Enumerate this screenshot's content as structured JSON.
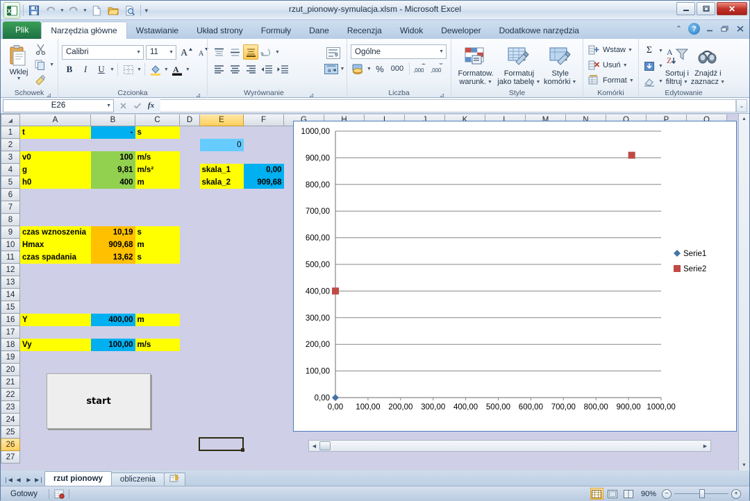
{
  "window": {
    "title": "rzut_pionowy-symulacja.xlsm  -  Microsoft Excel",
    "minimize": "–",
    "maximize": "❐",
    "close": "✕"
  },
  "qat": {
    "excel_logo": "X",
    "save": "save-icon",
    "undo": "↶",
    "redo": "↷",
    "new": "new-icon",
    "open": "open-icon",
    "print_preview": "print-preview-icon",
    "customize": "▼"
  },
  "ribbon_tabs": [
    {
      "label": "Plik",
      "type": "file"
    },
    {
      "label": "Narzędzia główne",
      "type": "active"
    },
    {
      "label": "Wstawianie",
      "type": "normal"
    },
    {
      "label": "Układ strony",
      "type": "normal"
    },
    {
      "label": "Formuły",
      "type": "normal"
    },
    {
      "label": "Dane",
      "type": "normal"
    },
    {
      "label": "Recenzja",
      "type": "normal"
    },
    {
      "label": "Widok",
      "type": "normal"
    },
    {
      "label": "Deweloper",
      "type": "normal"
    },
    {
      "label": "Dodatkowe narzędzia",
      "type": "normal"
    }
  ],
  "ribbon_right": {
    "collapse": "⌃",
    "help": "?",
    "minimize": "–",
    "restore": "❐",
    "close": "✕"
  },
  "groups": {
    "clipboard": {
      "label": "Schowek",
      "paste": "Wklej",
      "cut": "cut-icon",
      "copy": "copy-icon",
      "format_painter": "format-painter-icon"
    },
    "font": {
      "label": "Czcionka",
      "font_name": "Calibri",
      "font_size": "11",
      "grow": "A",
      "shrink": "A",
      "bold": "B",
      "italic": "I",
      "underline": "U",
      "borders": "borders-icon",
      "fill": "fill-color-icon",
      "fontcolor": "font-color-icon"
    },
    "alignment": {
      "label": "Wyrównanie",
      "top": "align-top-icon",
      "middle": "align-middle-icon",
      "bottom": "align-bottom-icon",
      "orientation": "orientation-icon",
      "left": "align-left-icon",
      "center": "align-center-icon",
      "right": "align-right-icon",
      "decrease_indent": "decrease-indent-icon",
      "increase_indent": "increase-indent-icon",
      "wrap_text": "wrap-text-icon",
      "merge": "merge-cells-icon"
    },
    "number": {
      "label": "Liczba",
      "format": "Ogólne",
      "currency": "currency-icon",
      "percent": "%",
      "comma": "000",
      "increase_decimal": "increase-decimal-icon",
      "decrease_decimal": "decrease-decimal-icon"
    },
    "styles": {
      "label": "Style",
      "conditional": "Formatow.\nwarunk.",
      "conditional_l1": "Formatow.",
      "conditional_l2": "warunk.",
      "as_table_l1": "Formatuj",
      "as_table_l2": "jako tabelę",
      "cell_styles_l1": "Style",
      "cell_styles_l2": "komórki"
    },
    "cells": {
      "label": "Komórki",
      "insert": "Wstaw",
      "delete": "Usuń",
      "format": "Format"
    },
    "editing": {
      "label": "Edytowanie",
      "autosum": "Σ",
      "fill": "fill-down-icon",
      "clear": "clear-icon",
      "sort_l1": "Sortuj i",
      "sort_l2": "filtruj",
      "find_l1": "Znajdź i",
      "find_l2": "zaznacz"
    }
  },
  "formula_bar": {
    "name_box": "E26",
    "formula": "",
    "fx": "fx",
    "cancel": "✕",
    "accept": "✓",
    "expand": "⌄"
  },
  "grid": {
    "columns": [
      "A",
      "B",
      "C",
      "D",
      "E",
      "F",
      "G",
      "H",
      "I",
      "J",
      "K",
      "L",
      "M",
      "N",
      "O",
      "P",
      "Q"
    ],
    "selected_column": "E",
    "selected_row": 26,
    "selected_cell": "E26",
    "rows": [
      1,
      2,
      3,
      4,
      5,
      6,
      7,
      8,
      9,
      10,
      11,
      12,
      13,
      14,
      15,
      16,
      17,
      18,
      19,
      20,
      21,
      22,
      23,
      24,
      25,
      26,
      27
    ],
    "cells": [
      {
        "row": 1,
        "col": "A",
        "value": "t",
        "style": "yl"
      },
      {
        "row": 1,
        "col": "B",
        "value": "-",
        "style": "cy"
      },
      {
        "row": 1,
        "col": "C",
        "value": "s",
        "style": "yl"
      },
      {
        "row": 2,
        "col": "E",
        "value": "0",
        "style": "cy2"
      },
      {
        "row": 3,
        "col": "A",
        "value": "v0",
        "style": "yl"
      },
      {
        "row": 3,
        "col": "B",
        "value": "100",
        "style": "gr"
      },
      {
        "row": 3,
        "col": "C",
        "value": "m/s",
        "style": "yl"
      },
      {
        "row": 4,
        "col": "A",
        "value": "g",
        "style": "yl"
      },
      {
        "row": 4,
        "col": "B",
        "value": "9,81",
        "style": "gr"
      },
      {
        "row": 4,
        "col": "C",
        "value": "m/s²",
        "style": "yl"
      },
      {
        "row": 4,
        "col": "E",
        "value": "skala_1",
        "style": "yl"
      },
      {
        "row": 4,
        "col": "F",
        "value": "0,00",
        "style": "cy"
      },
      {
        "row": 5,
        "col": "A",
        "value": "h0",
        "style": "yl"
      },
      {
        "row": 5,
        "col": "B",
        "value": "400",
        "style": "gr"
      },
      {
        "row": 5,
        "col": "C",
        "value": "m",
        "style": "yl"
      },
      {
        "row": 5,
        "col": "E",
        "value": "skala_2",
        "style": "yl"
      },
      {
        "row": 5,
        "col": "F",
        "value": "909,68",
        "style": "cy"
      },
      {
        "row": 9,
        "col": "A",
        "value": "czas wznoszenia",
        "style": "yl"
      },
      {
        "row": 9,
        "col": "B",
        "value": "10,19",
        "style": "og"
      },
      {
        "row": 9,
        "col": "C",
        "value": "s",
        "style": "yl"
      },
      {
        "row": 10,
        "col": "A",
        "value": "Hmax",
        "style": "yl"
      },
      {
        "row": 10,
        "col": "B",
        "value": "909,68",
        "style": "og"
      },
      {
        "row": 10,
        "col": "C",
        "value": "m",
        "style": "yl"
      },
      {
        "row": 11,
        "col": "A",
        "value": "czas spadania",
        "style": "yl"
      },
      {
        "row": 11,
        "col": "B",
        "value": "13,62",
        "style": "og"
      },
      {
        "row": 11,
        "col": "C",
        "value": "s",
        "style": "yl"
      },
      {
        "row": 16,
        "col": "A",
        "value": "Y",
        "style": "yl"
      },
      {
        "row": 16,
        "col": "B",
        "value": "400,00",
        "style": "cy"
      },
      {
        "row": 16,
        "col": "C",
        "value": "m",
        "style": "yl"
      },
      {
        "row": 18,
        "col": "A",
        "value": "Vy",
        "style": "yl"
      },
      {
        "row": 18,
        "col": "B",
        "value": "100,00",
        "style": "cy"
      },
      {
        "row": 18,
        "col": "C",
        "value": "m/s",
        "style": "yl"
      }
    ]
  },
  "start_button": {
    "label": "start"
  },
  "chart_data": {
    "type": "scatter",
    "title": "",
    "xlabel": "",
    "ylabel": "",
    "xlim": [
      0,
      1000
    ],
    "ylim": [
      0,
      1000
    ],
    "xticks": [
      "0,00",
      "100,00",
      "200,00",
      "300,00",
      "400,00",
      "500,00",
      "600,00",
      "700,00",
      "800,00",
      "900,00",
      "1000,00"
    ],
    "yticks": [
      "0,00",
      "100,00",
      "200,00",
      "300,00",
      "400,00",
      "500,00",
      "600,00",
      "700,00",
      "800,00",
      "900,00",
      "1000,00"
    ],
    "grid": "horizontal",
    "legend_position": "right",
    "series": [
      {
        "name": "Serie1",
        "color": "#4572a7",
        "marker": "diamond",
        "points": [
          {
            "x": 0,
            "y": 0
          }
        ]
      },
      {
        "name": "Serie2",
        "color": "#bf4a45",
        "marker": "square",
        "points": [
          {
            "x": 0,
            "y": 400
          },
          {
            "x": 909.68,
            "y": 909.68
          }
        ]
      }
    ]
  },
  "sheet_tabs": {
    "nav_first": "❘◀",
    "nav_prev": "◀",
    "nav_next": "▶",
    "nav_last": "▶❘",
    "tabs": [
      {
        "label": "rzut pionowy",
        "active": true
      },
      {
        "label": "obliczenia",
        "active": false
      }
    ],
    "new_sheet": "new-sheet-icon"
  },
  "scrollbars": {
    "left_arrow": "◀",
    "right_arrow": "▶",
    "up_arrow": "▲",
    "down_arrow": "▼"
  },
  "status_bar": {
    "status": "Gotowy",
    "macro_record": "record-macro-icon",
    "view_normal": "normal-view-icon",
    "view_layout": "page-layout-view-icon",
    "view_break": "page-break-view-icon",
    "zoom": "90%",
    "zoom_out": "−",
    "zoom_in": "+"
  },
  "colors": {
    "yellow": "#FFFF00",
    "cyan": "#00B0F0",
    "light_blue": "#66CCFF",
    "green": "#92D050",
    "orange": "#FFC000",
    "sheet_bg": "#CFCFE8",
    "series1": "#4572A7",
    "series2": "#BF4A45",
    "excel_green": "#1E7145"
  }
}
